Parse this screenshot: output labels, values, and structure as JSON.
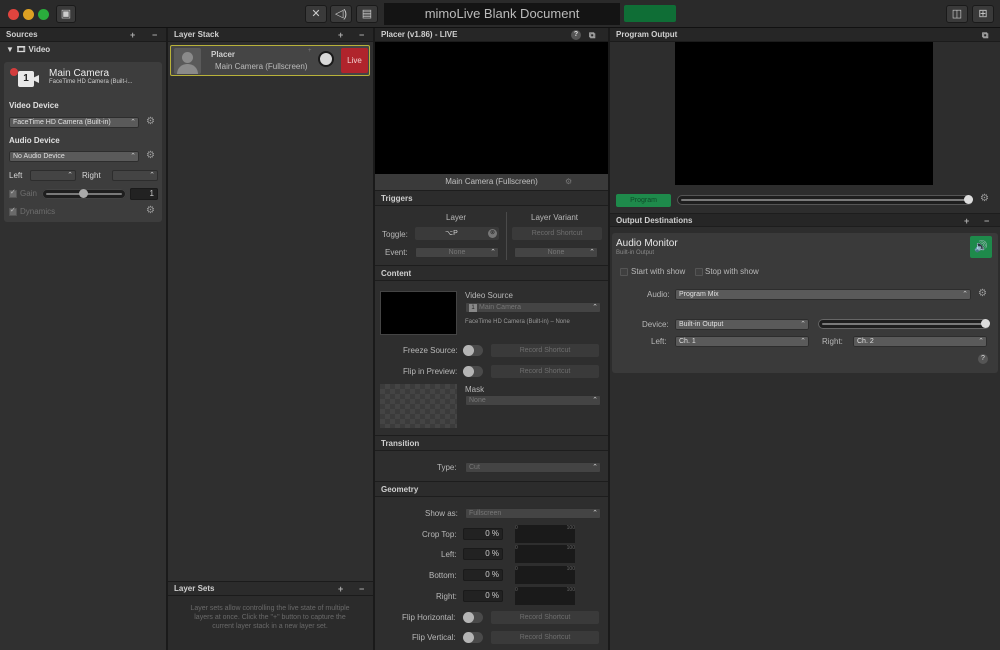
{
  "app": {
    "title": "mimoLive Blank Document"
  },
  "sources": {
    "header": "Sources",
    "add": "+",
    "remove": "−",
    "group": "Video",
    "camera": {
      "badge": "1",
      "name": "Main Camera",
      "subtitle": "FaceTime HD Camera (Built-i..."
    },
    "video_device_label": "Video Device",
    "video_device_value": "FaceTime HD Camera (Built-in)",
    "audio_device_label": "Audio Device",
    "audio_device_value": "No Audio Device",
    "left_label": "Left",
    "right_label": "Right",
    "gain_label": "Gain",
    "gain_value": "1",
    "dynamics_label": "Dynamics"
  },
  "layer_stack": {
    "header": "Layer Stack",
    "add": "+",
    "remove": "−",
    "layer": {
      "name": "Placer",
      "subtitle": "Main Camera (Fullscreen)",
      "live_label": "Live",
      "volume_max": "+"
    },
    "layer_sets": {
      "header": "Layer Sets",
      "help": "Layer sets allow controlling the live state of multiple layers at once. Click the \"+\" button to capture the current layer stack in a new layer set."
    }
  },
  "placer": {
    "header": "Placer (v1.86) - LIVE",
    "help": "?",
    "preview_caption": "Main Camera (Fullscreen)",
    "triggers": {
      "title": "Triggers",
      "layer_col": "Layer",
      "variant_col": "Layer Variant",
      "toggle_label": "Toggle:",
      "toggle_shortcut": "⌥P",
      "variant_shortcut": "Record Shortcut",
      "event_label": "Event:",
      "event_layer": "None",
      "event_variant": "None"
    },
    "content": {
      "title": "Content",
      "video_source_label": "Video Source",
      "video_source_value": "Main Camera",
      "video_source_badge": "1",
      "video_source_info": "FaceTime HD Camera (Built-in) – None",
      "freeze_label": "Freeze Source:",
      "freeze_shortcut": "Record Shortcut",
      "flip_preview_label": "Flip in Preview:",
      "flip_preview_shortcut": "Record Shortcut",
      "mask_label": "Mask",
      "mask_value": "None"
    },
    "transition": {
      "title": "Transition",
      "type_label": "Type:",
      "type_value": "Cut"
    },
    "geometry": {
      "title": "Geometry",
      "show_as_label": "Show as:",
      "show_as_value": "Fullscreen",
      "crop_top_label": "Crop Top:",
      "crop_top_value": "0 %",
      "left_label": "Left:",
      "left_value": "0 %",
      "bottom_label": "Bottom:",
      "bottom_value": "0 %",
      "right_label": "Right:",
      "right_value": "0 %",
      "meter_min": "0",
      "meter_max": "100",
      "flip_h_label": "Flip Horizontal:",
      "flip_h_shortcut": "Record Shortcut",
      "flip_v_label": "Flip Vertical:",
      "flip_v_shortcut": "Record Shortcut"
    }
  },
  "program": {
    "header": "Program Output",
    "program_button": "Program",
    "output_destinations": "Output Destinations",
    "add": "+",
    "remove": "−",
    "monitor": {
      "title": "Audio Monitor",
      "subtitle": "Built-in Output",
      "start_label": "Start with show",
      "stop_label": "Stop with show",
      "audio_label": "Audio:",
      "audio_value": "Program Mix",
      "device_label": "Device:",
      "device_value": "Built-in Output",
      "left_label": "Left:",
      "left_value": "Ch. 1",
      "right_label": "Right:",
      "right_value": "Ch. 2",
      "help": "?"
    }
  },
  "colors": {
    "live": "#b0242c",
    "accent_green": "#1e8a4b",
    "highlight": "#b9b23a"
  }
}
